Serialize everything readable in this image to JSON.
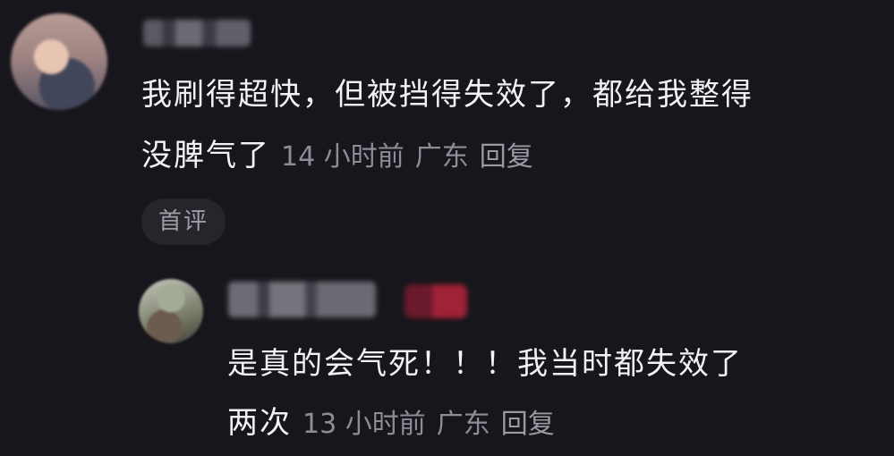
{
  "comments": [
    {
      "text_line1": "我刷得超快，但被挡得失效了，都给我整得",
      "text_line2": "没脾气了",
      "time": "14 小时前",
      "location": "广东",
      "reply_label": "回复",
      "tag": "首评"
    }
  ],
  "replies": [
    {
      "text_line1": "是真的会气死！！！我当时都失效了",
      "text_line2": "两次",
      "time": "13 小时前",
      "location": "广东",
      "reply_label": "回复"
    }
  ]
}
